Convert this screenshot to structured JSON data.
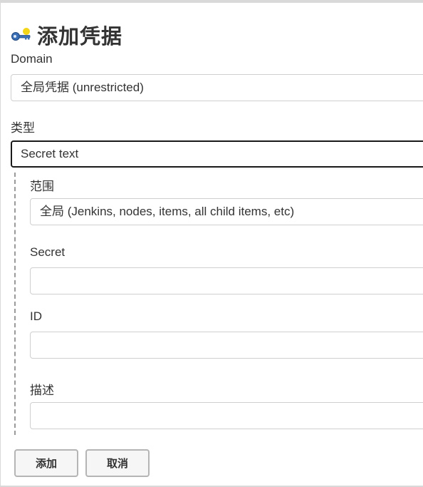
{
  "page": {
    "title": "添加凭据",
    "icon": "key-icon"
  },
  "domain": {
    "label": "Domain",
    "value": "全局凭据 (unrestricted)"
  },
  "kind": {
    "label": "类型",
    "value": "Secret text"
  },
  "scope": {
    "label": "范围",
    "value": "全局 (Jenkins, nodes, items, all child items, etc)"
  },
  "secret": {
    "label": "Secret",
    "value": ""
  },
  "id": {
    "label": "ID",
    "value": ""
  },
  "description": {
    "label": "描述",
    "value": ""
  },
  "buttons": {
    "add": "添加",
    "cancel": "取消"
  }
}
